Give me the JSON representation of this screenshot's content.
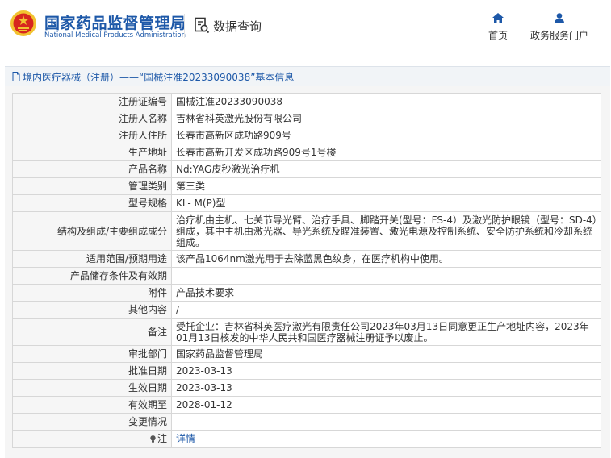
{
  "header": {
    "agency_name_cn": "国家药品监督管理局",
    "agency_name_en": "National Medical Products Administration",
    "data_query_label": "数据查询",
    "nav": {
      "home": "首页",
      "gov_services": "政务服务门户"
    }
  },
  "breadcrumb": "境内医疗器械（注册）——“国械注准20233090038”基本信息",
  "record": [
    {
      "key": "注册证编号",
      "value": "国械注准20233090038"
    },
    {
      "key": "注册人名称",
      "value": "吉林省科英激光股份有限公司"
    },
    {
      "key": "注册人住所",
      "value": "长春市高新区成功路909号"
    },
    {
      "key": "生产地址",
      "value": "长春市高新开发区成功路909号1号楼"
    },
    {
      "key": "产品名称",
      "value": "Nd:YAG皮秒激光治疗机"
    },
    {
      "key": "管理类别",
      "value": "第三类"
    },
    {
      "key": "型号规格",
      "value": "KL- M(P)型"
    },
    {
      "key": "结构及组成/主要组成成分",
      "value": "治疗机由主机、七关节导光臂、治疗手具、脚踏开关(型号：FS-4）及激光防护眼镜（型号：SD-4）组成，其中主机由激光器、导光系统及瞄准装置、激光电源及控制系统、安全防护系统和冷却系统组成。"
    },
    {
      "key": "适用范围/预期用途",
      "value": "该产品1064nm激光用于去除蓝黑色纹身，在医疗机构中使用。"
    },
    {
      "key": "产品储存条件及有效期",
      "value": ""
    },
    {
      "key": "附件",
      "value": "产品技术要求"
    },
    {
      "key": "其他内容",
      "value": "/"
    },
    {
      "key": "备注",
      "value": "受托企业：吉林省科英医疗激光有限责任公司2023年03月13日同意更正生产地址内容，2023年01月13日核发的中华人民共和国医疗器械注册证予以废止。"
    },
    {
      "key": "审批部门",
      "value": "国家药品监督管理局"
    },
    {
      "key": "批准日期",
      "value": "2023-03-13"
    },
    {
      "key": "生效日期",
      "value": "2023-03-13"
    },
    {
      "key": "有效期至",
      "value": "2028-01-12"
    },
    {
      "key": "变更情况",
      "value": ""
    },
    {
      "key": "注",
      "value": "详情"
    }
  ],
  "colors": {
    "brand": "#1d58a8",
    "emblem_red": "#d7261e",
    "emblem_gold": "#f2c230"
  },
  "icons": [
    "national-emblem-icon",
    "data-query-icon",
    "home-icon",
    "user-icon",
    "document-icon",
    "lightbulb-icon"
  ]
}
